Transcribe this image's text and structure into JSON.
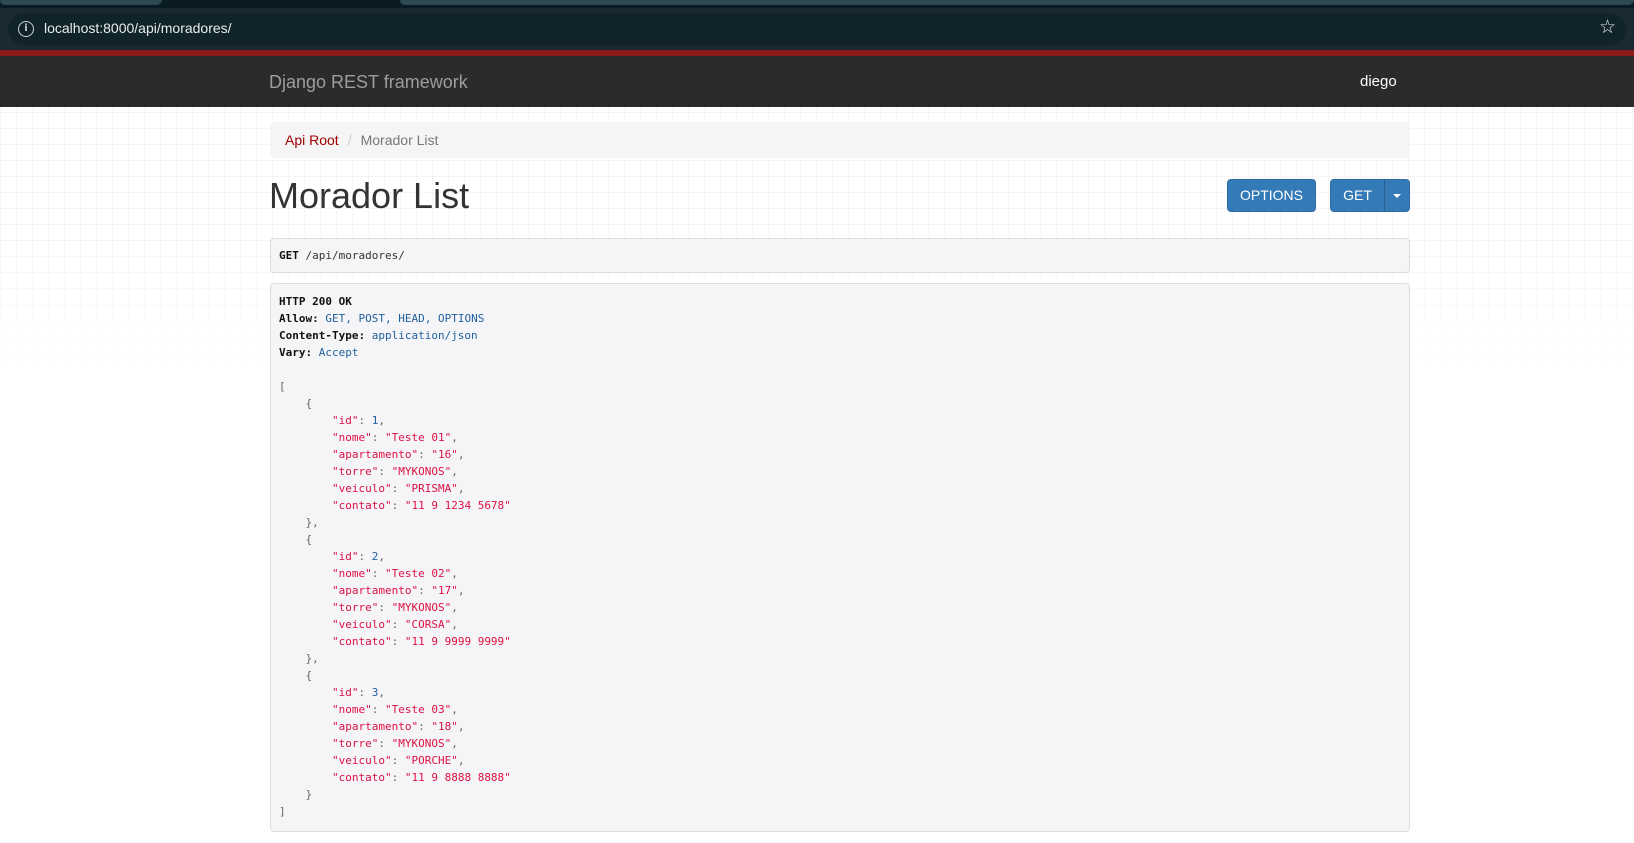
{
  "browser": {
    "url": "localhost:8000/api/moradores/",
    "site_info_icon": "info-circle-icon",
    "bookmark_icon": "star-outline-icon"
  },
  "navbar": {
    "brand": "Django REST framework",
    "user": "diego"
  },
  "breadcrumb": {
    "items": [
      {
        "label": "Api Root",
        "link": true
      },
      {
        "label": "Morador List",
        "link": false
      }
    ],
    "separator": "/"
  },
  "page": {
    "title": "Morador List",
    "options_button": "OPTIONS",
    "get_button": "GET"
  },
  "request": {
    "method": "GET",
    "path": " /api/moradores/"
  },
  "response": {
    "status": "HTTP 200 OK",
    "headers": [
      {
        "name": "Allow:",
        "value": " GET, POST, HEAD, OPTIONS"
      },
      {
        "name": "Content-Type:",
        "value": " application/json"
      },
      {
        "name": "Vary:",
        "value": " Accept"
      }
    ],
    "body": [
      {
        "id": 1,
        "nome": "Teste 01",
        "apartamento": "16",
        "torre": "MYKONOS",
        "veiculo": "PRISMA",
        "contato": "11 9 1234 5678"
      },
      {
        "id": 2,
        "nome": "Teste 02",
        "apartamento": "17",
        "torre": "MYKONOS",
        "veiculo": "CORSA",
        "contato": "11 9 9999 9999"
      },
      {
        "id": 3,
        "nome": "Teste 03",
        "apartamento": "18",
        "torre": "MYKONOS",
        "veiculo": "PORCHE",
        "contato": "11 9 8888 8888"
      }
    ]
  },
  "colors": {
    "navbar": "#2b2b2b",
    "accent_red": "#a30000",
    "button_blue": "#337ab7",
    "json_string": "#dd1144",
    "json_literal": "#1f5f9e"
  }
}
